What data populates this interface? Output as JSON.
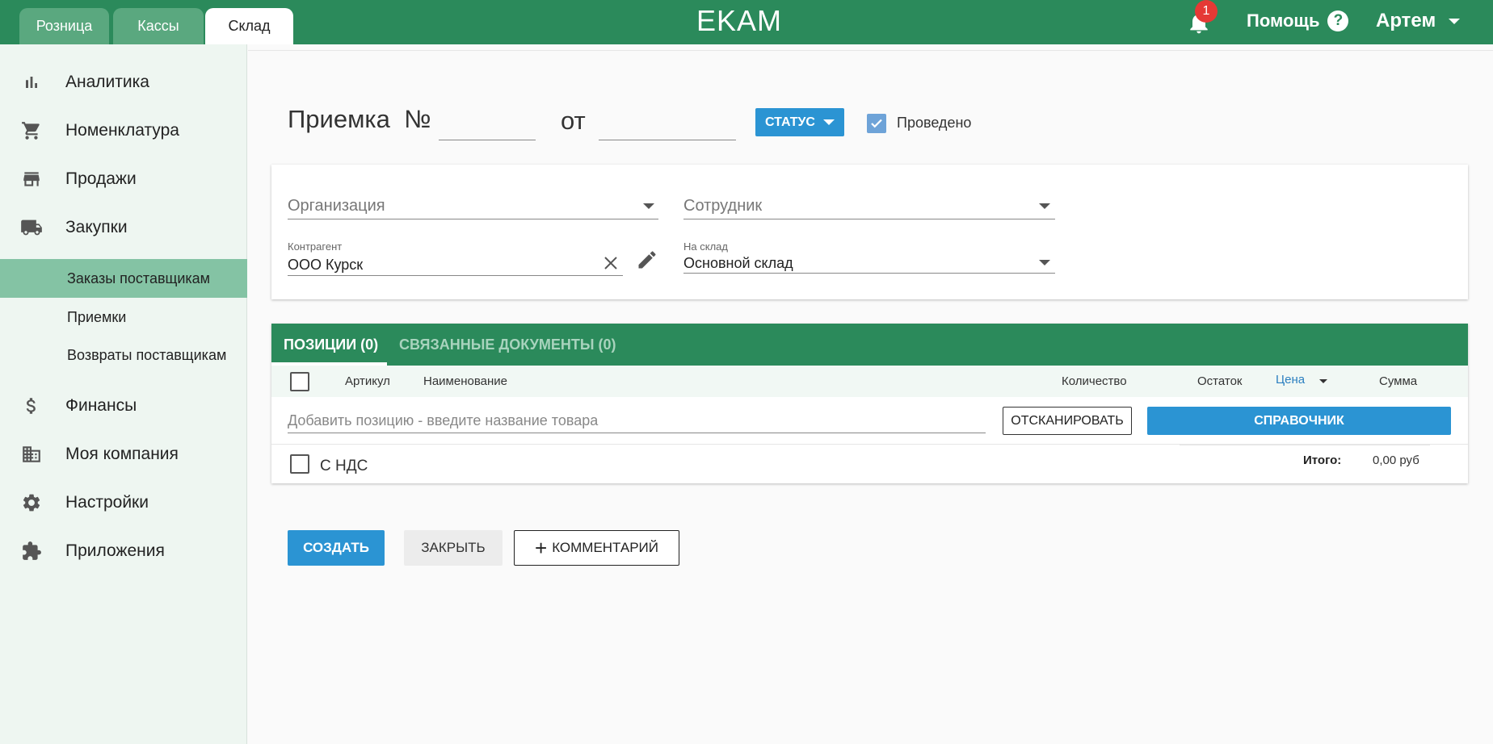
{
  "topbar": {
    "tabs": [
      {
        "label": "Розница"
      },
      {
        "label": "Кассы"
      },
      {
        "label": "Склад"
      }
    ],
    "logo": "EKAM",
    "notifications_count": "1",
    "help_label": "Помощь",
    "help_icon": "?",
    "user_name": "Артем"
  },
  "sidebar": {
    "items": [
      {
        "label": "Аналитика",
        "icon": "bar-chart-icon"
      },
      {
        "label": "Номенклатура",
        "icon": "cart-icon"
      },
      {
        "label": "Продажи",
        "icon": "store-icon"
      },
      {
        "label": "Закупки",
        "icon": "truck-icon"
      },
      {
        "label": "Финансы",
        "icon": "dollar-icon"
      },
      {
        "label": "Моя компания",
        "icon": "building-icon"
      },
      {
        "label": "Настройки",
        "icon": "gear-icon"
      },
      {
        "label": "Приложения",
        "icon": "puzzle-icon"
      }
    ],
    "subitems": [
      {
        "label": "Заказы поставщикам",
        "active": true
      },
      {
        "label": "Приемки",
        "active": false
      },
      {
        "label": "Возвраты поставщикам",
        "active": false
      }
    ]
  },
  "document": {
    "title": "Приемка  №",
    "number_value": "",
    "date_label": "от",
    "date_value": "",
    "status_button": "СТАТУС",
    "posted_label": "Проведено",
    "posted_checked": true
  },
  "form": {
    "organization_placeholder": "Организация",
    "employee_placeholder": "Сотрудник",
    "counterparty_caption": "Контрагент",
    "counterparty_value": "ООО Курск",
    "warehouse_caption": "На склад",
    "warehouse_value": "Основной склад"
  },
  "positions": {
    "tabs": [
      {
        "label": "ПОЗИЦИИ (0)"
      },
      {
        "label": "СВЯЗАННЫЕ ДОКУМЕНТЫ (0)"
      }
    ],
    "columns": {
      "article": "Артикул",
      "name": "Наименование",
      "quantity": "Количество",
      "remainder": "Остаток",
      "price": "Цена",
      "sum": "Сумма"
    },
    "add_placeholder": "Добавить позицию - введите название товара",
    "scan_button": "ОТСКАНИРОВАТЬ",
    "reference_button": "СПРАВОЧНИК",
    "vat_label": "С НДС",
    "total_label": "Итого:",
    "total_value": "0,00 руб"
  },
  "actions": {
    "create": "СОЗДАТЬ",
    "close": "ЗАКРЫТЬ",
    "comment": "КОММЕНТАРИЙ"
  },
  "colors": {
    "brand_green": "#2b8a5b",
    "primary_blue": "#2b94d3",
    "active_submenu": "#84c3a4"
  }
}
